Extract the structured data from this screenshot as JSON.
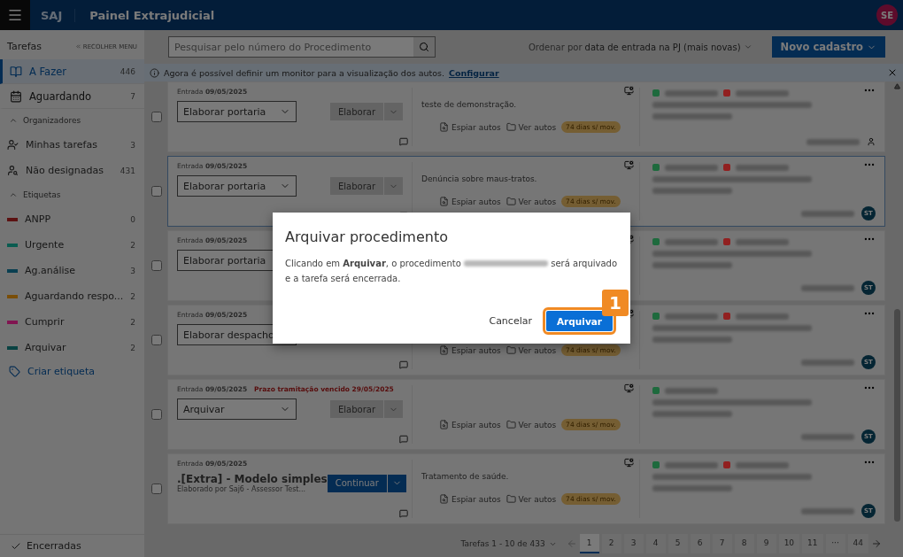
{
  "header": {
    "app": "SAJ",
    "title": "Painel Extrajudicial",
    "avatar": "SE"
  },
  "sidebar": {
    "title": "Tarefas",
    "collapse": "RECOLHER MENU",
    "main_items": [
      {
        "label": "A Fazer",
        "count": "446",
        "selected": true,
        "kind": "todo"
      },
      {
        "label": "Aguardando",
        "count": "7",
        "selected": false,
        "kind": "waiting"
      }
    ],
    "organizers": {
      "label": "Organizadores",
      "expanded": true,
      "items": [
        {
          "label": "Minhas tarefas",
          "count": "3",
          "kind": "mine"
        },
        {
          "label": "Não designadas",
          "count": "431",
          "kind": "unassigned"
        }
      ]
    },
    "labels": {
      "label": "Etiquetas",
      "expanded": true,
      "items": [
        {
          "label": "ANPP",
          "count": "0",
          "color": "#5c1212"
        },
        {
          "label": "Urgente",
          "count": "2",
          "color": "#0a5c50"
        },
        {
          "label": "Ag.análise",
          "count": "3",
          "color": "#093f51"
        },
        {
          "label": "Aguardando respo...",
          "count": "2",
          "color": "#7a4e08"
        },
        {
          "label": "Cumprir",
          "count": "2",
          "color": "#811551"
        },
        {
          "label": "Arquivar",
          "count": "2",
          "color": "#094242"
        }
      ]
    },
    "create_label": "Criar etiqueta",
    "closed": "Encerradas"
  },
  "toolbar": {
    "search_placeholder": "Pesquisar pelo número do Procedimento",
    "sort_prefix": "Ordenar por",
    "sort_value": "data de entrada na PJ (mais novas)",
    "new_button": "Novo cadastro"
  },
  "banner": {
    "text": "Agora é possível definir um monitor para a visualização dos autos.",
    "link": "Configurar"
  },
  "cards": [
    {
      "kind": "select",
      "checked": false,
      "entry_label": "Entrada",
      "entry_date": "09/05/2025",
      "task": "Elaborar portaria",
      "action": "Elaborar",
      "primary": false,
      "selected": false,
      "description": "teste de demonstração.",
      "links": [
        "Espiar autos",
        "Ver autos"
      ],
      "badge": "74 dias s/ mov.",
      "tags": [
        {
          "color": "#1e6a3d"
        },
        {
          "color": "#912020"
        }
      ]
    },
    {
      "kind": "select",
      "checked": false,
      "entry_label": "Entrada",
      "entry_date": "09/05/2025",
      "task": "Elaborar portaria",
      "action": "Elaborar",
      "primary": false,
      "selected": true,
      "description": "Denúncia sobre maus-tratos.",
      "links": [
        "Espiar autos",
        "Ver autos"
      ],
      "badge": "74 dias s/ mov.",
      "tags": [
        {
          "color": "#1e6a3d"
        },
        {
          "color": "#912020"
        }
      ],
      "assignee": "ST"
    },
    {
      "kind": "select",
      "checked": false,
      "entry_label": "Entrada",
      "entry_date": "09/05/2025",
      "task": "Elaborar portaria",
      "selected": false,
      "tags": [
        {
          "color": "#1e6a3d"
        },
        {
          "color": "#912020"
        }
      ],
      "assignee": "ST"
    },
    {
      "kind": "select",
      "checked": false,
      "entry_label": "Entrada",
      "entry_date": "09/05/2025",
      "task": "Elaborar despacho",
      "selected": false,
      "links": [
        "Espiar autos",
        "Ver autos"
      ],
      "badge": "74 dias s/ mov.",
      "tags": [
        {
          "color": "#1e6a3d"
        },
        {
          "color": "#912020"
        }
      ],
      "assignee": "ST"
    },
    {
      "kind": "select",
      "checked": false,
      "entry_label": "Entrada",
      "entry_date": "09/05/2025",
      "warning": "Prazo tramitação vencido 29/05/2025",
      "task": "Arquivar",
      "action": "Elaborar",
      "primary": false,
      "selected": false,
      "links": [
        "Espiar autos",
        "Ver autos"
      ],
      "badge": "74 dias s/ mov.",
      "tags": [
        {
          "color": "#1e6a3d"
        }
      ],
      "assignee": "ST"
    },
    {
      "kind": "document",
      "checked": false,
      "entry_label": "Entrada",
      "entry_date": "09/05/2025",
      "task": ".[Extra] - Modelo simples",
      "subtitle": "Elaborado por Saj6 - Assessor Test...",
      "action": "Continuar",
      "primary": true,
      "selected": false,
      "description": "Tratamento de saúde.",
      "links": [
        "Espiar autos",
        "Ver autos"
      ],
      "badge": "74 dias s/ mov.",
      "tags": [
        {
          "color": "#1e6a3d"
        },
        {
          "color": "#912020"
        }
      ],
      "assignee": "ST"
    }
  ],
  "pagination": {
    "summary": "Tarefas 1 - 10 de 433",
    "pages": [
      {
        "label": "1",
        "selected": true
      },
      {
        "label": "2",
        "selected": false
      },
      {
        "label": "3",
        "selected": false
      },
      {
        "label": "4",
        "selected": false
      },
      {
        "label": "5",
        "selected": false
      },
      {
        "label": "6",
        "selected": false
      },
      {
        "label": "7",
        "selected": false
      },
      {
        "label": "8",
        "selected": false
      },
      {
        "label": "9",
        "selected": false
      },
      {
        "label": "10",
        "selected": false
      },
      {
        "label": "11",
        "selected": false
      },
      {
        "label": "···",
        "selected": false
      },
      {
        "label": "44",
        "selected": false
      }
    ]
  },
  "dialog": {
    "title": "Arquivar procedimento",
    "text_before": "Clicando em **Arquivar**, o procedimento",
    "text_after": "será arquivado e a tarefa será encerrada.",
    "cancel": "Cancelar",
    "confirm": "Arquivar",
    "step": "1"
  }
}
